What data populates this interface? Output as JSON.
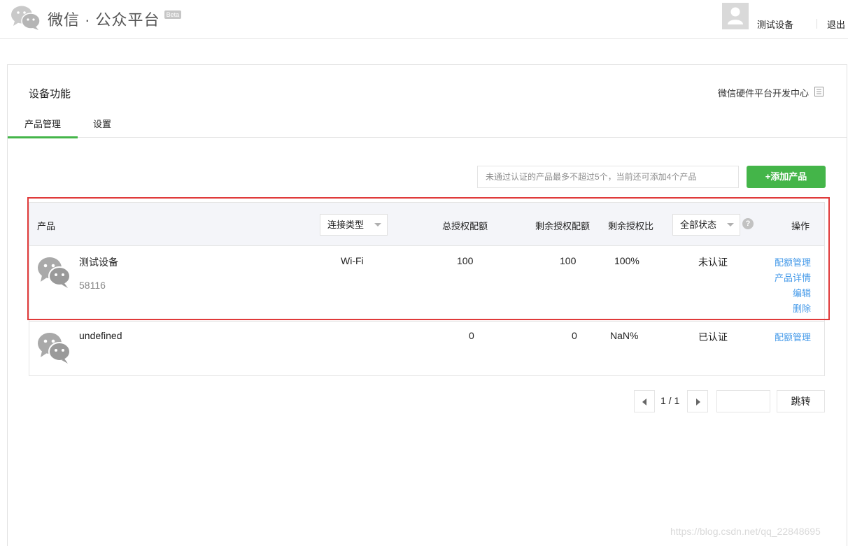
{
  "header": {
    "app_title": "微信 · 公众平台",
    "badge": "Beta",
    "user_name": "测试设备",
    "logout_label": "退出"
  },
  "page": {
    "title": "设备功能",
    "dev_center_link": "微信硬件平台开发中心",
    "tabs": [
      {
        "label": "产品管理",
        "active": true
      },
      {
        "label": "设置",
        "active": false
      }
    ],
    "notice": "未通过认证的产品最多不超过5个，当前还可添加4个产品",
    "add_button": "+添加产品"
  },
  "table": {
    "headers": {
      "product": "产品",
      "connection_type": "连接类型",
      "total_quota": "总授权配额",
      "remaining_quota": "剩余授权配额",
      "remaining_ratio": "剩余授权比",
      "status_filter": "全部状态",
      "help": "?",
      "actions": "操作"
    },
    "rows": [
      {
        "name": "测试设备",
        "id": "58116",
        "connection_type": "Wi-Fi",
        "total_quota": "100",
        "remaining_quota": "100",
        "remaining_ratio": "100%",
        "status": "未认证",
        "actions": [
          "配额管理",
          "产品详情",
          "编辑",
          "删除"
        ]
      },
      {
        "name": "undefined",
        "id": "",
        "connection_type": "",
        "total_quota": "0",
        "remaining_quota": "0",
        "remaining_ratio": "NaN%",
        "status": "已认证",
        "actions": [
          "配额管理"
        ]
      }
    ]
  },
  "pagination": {
    "current": "1 / 1",
    "jump_label": "跳转",
    "input_value": ""
  },
  "watermark": "https://blog.csdn.net/qq_22848695",
  "colors": {
    "accent_green": "#44b549",
    "link_blue": "#459ae9",
    "highlight_red": "#e03a3a"
  }
}
